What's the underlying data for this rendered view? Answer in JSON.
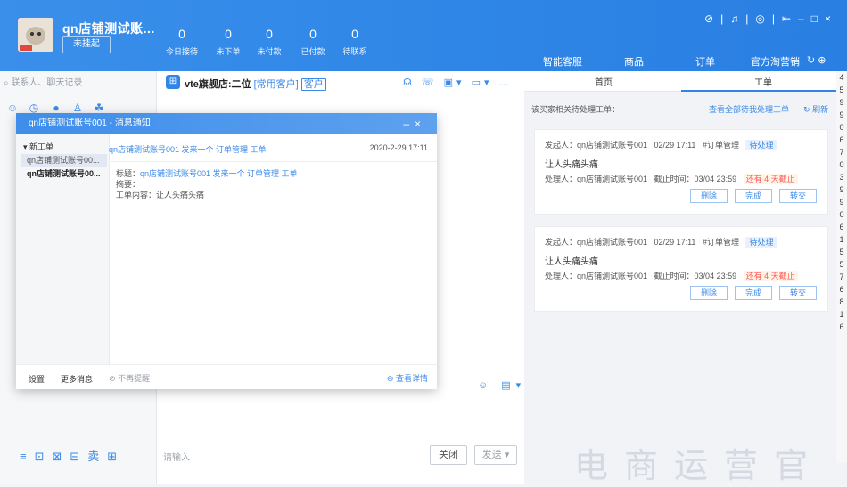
{
  "header": {
    "shop_name": "qn店铺测试账...",
    "status": "未挂起",
    "stats": [
      {
        "value": "0",
        "label": "今日接待"
      },
      {
        "value": "0",
        "label": "未下单"
      },
      {
        "value": "0",
        "label": "未付款"
      },
      {
        "value": "0",
        "label": "已付款"
      },
      {
        "value": "0",
        "label": "待联系"
      }
    ],
    "tabs": [
      "智能客服",
      "商品",
      "订单",
      "官方淘营销"
    ]
  },
  "left": {
    "search_placeholder": "联系人、聊天记录"
  },
  "chat": {
    "shop": "vte旗舰店:二位",
    "role": "[常用客户]",
    "tag": "客户",
    "quick_words": "请输入",
    "close_label": "关闭",
    "send_label": "发送 ▾"
  },
  "right": {
    "tabs": [
      "首页",
      "工单"
    ],
    "header": "该买家相关待处理工单：",
    "view_all": "查看全部待我处理工单",
    "refresh": "刷新",
    "cards": [
      {
        "initiator": "发起人：qn店铺测试账号001",
        "datetime": "02/29 17:11",
        "category": "#订单管理",
        "status": "待处理",
        "title": "让人头痛头痛",
        "handler": "处理人：qn店铺测试账号001",
        "deadline": "截止时间：03/04 23:59",
        "remain": "还有 4 天截止",
        "btn_delete": "删除",
        "btn_done": "完成",
        "btn_transfer": "转交"
      },
      {
        "initiator": "发起人：qn店铺测试账号001",
        "datetime": "02/29 17:11",
        "category": "#订单管理",
        "status": "待处理",
        "title": "让人头痛头痛",
        "handler": "处理人：qn店铺测试账号001",
        "deadline": "截止时间：03/04 23:59",
        "remain": "还有 4 天截止",
        "btn_delete": "删除",
        "btn_done": "完成",
        "btn_transfer": "转交"
      }
    ],
    "scroll_digits": [
      "4",
      "5",
      "9",
      "9",
      "0",
      "6",
      "7",
      "0",
      "3",
      "9",
      "9",
      "0",
      "6",
      "1",
      "5",
      "5",
      "7",
      "6",
      "8",
      "1",
      "6"
    ]
  },
  "popup": {
    "title": "qn店铺测试账号001 - 消息通知",
    "tree_root": "▾ 新工单",
    "tree_item1": "qn店铺测试账号00...",
    "tree_item2": "qn店铺测试账号00...",
    "msg_from": "qn店铺测试账号001 发来一个 订单管理 工单",
    "msg_time": "2020-2-29 17:11",
    "title_label": "标题：",
    "title_value": "qn店铺测试账号001 发来一个 订单管理 工单",
    "summary_label": "摘要：",
    "content": "工单内容：让人头痛头痛",
    "settings": "设置",
    "more": "更多消息",
    "no_remind": "不再提醒",
    "view_detail": "查看详情"
  },
  "watermark": "电商运营官"
}
